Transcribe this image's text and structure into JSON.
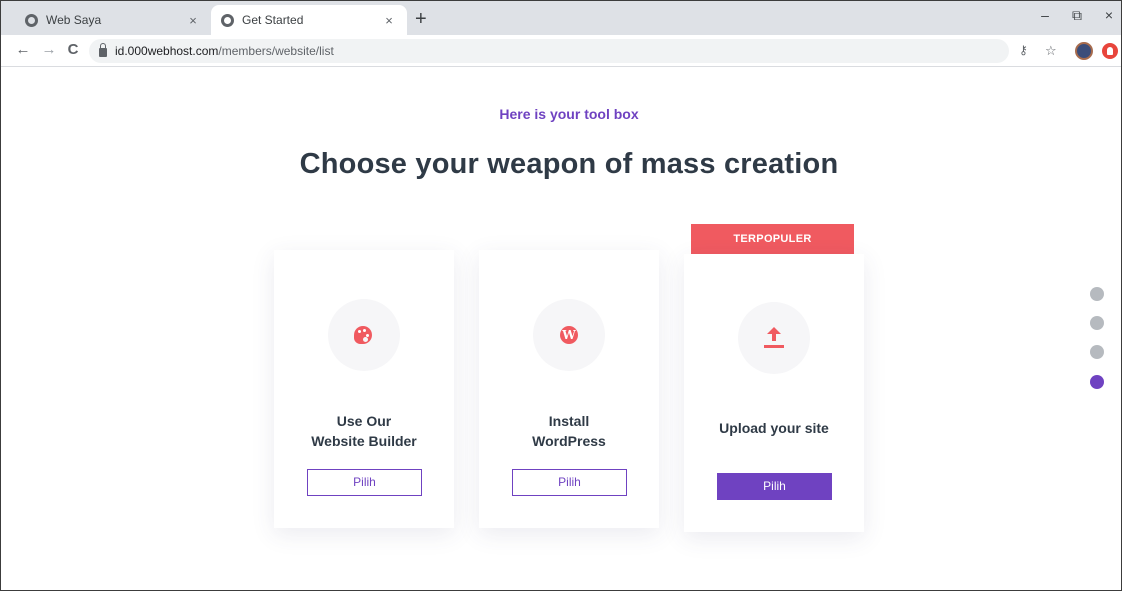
{
  "tabs": [
    {
      "title": "Web Saya",
      "close": "×",
      "active": false
    },
    {
      "title": "Get Started",
      "close": "×",
      "active": true
    }
  ],
  "new_tab": "+",
  "window_controls": {
    "minimize": "–",
    "restore": "⧉",
    "close": "×"
  },
  "nav": {
    "back": "←",
    "forward": "→",
    "reload": "C"
  },
  "address": {
    "host": "id.000webhost.com",
    "path": "/members/website/list"
  },
  "toolbar_icons": {
    "key": "key-icon",
    "star": "star-icon",
    "profile": "avatar",
    "extension": "extension-icon"
  },
  "page": {
    "eyebrow": "Here is your tool box",
    "headline": "Choose your weapon of mass creation",
    "badge": "TERPOPULER",
    "cards": [
      {
        "icon": "palette-icon",
        "line1": "Use Our",
        "line2": "Website Builder",
        "button": "Pilih",
        "button_style": "outline"
      },
      {
        "icon": "wordpress-icon",
        "icon_glyph": "W",
        "line1": "Install",
        "line2": "WordPress",
        "button": "Pilih",
        "button_style": "outline"
      },
      {
        "icon": "upload-icon",
        "line1": "Upload your site",
        "button": "Pilih",
        "button_style": "solid"
      }
    ],
    "pager": {
      "count": 4,
      "active_index": 3
    }
  },
  "colors": {
    "accent": "#6f42c1",
    "badge": "#f05a60",
    "icon": "#f05a60",
    "heading": "#2f3a46",
    "dot_inactive": "#b6babf"
  }
}
